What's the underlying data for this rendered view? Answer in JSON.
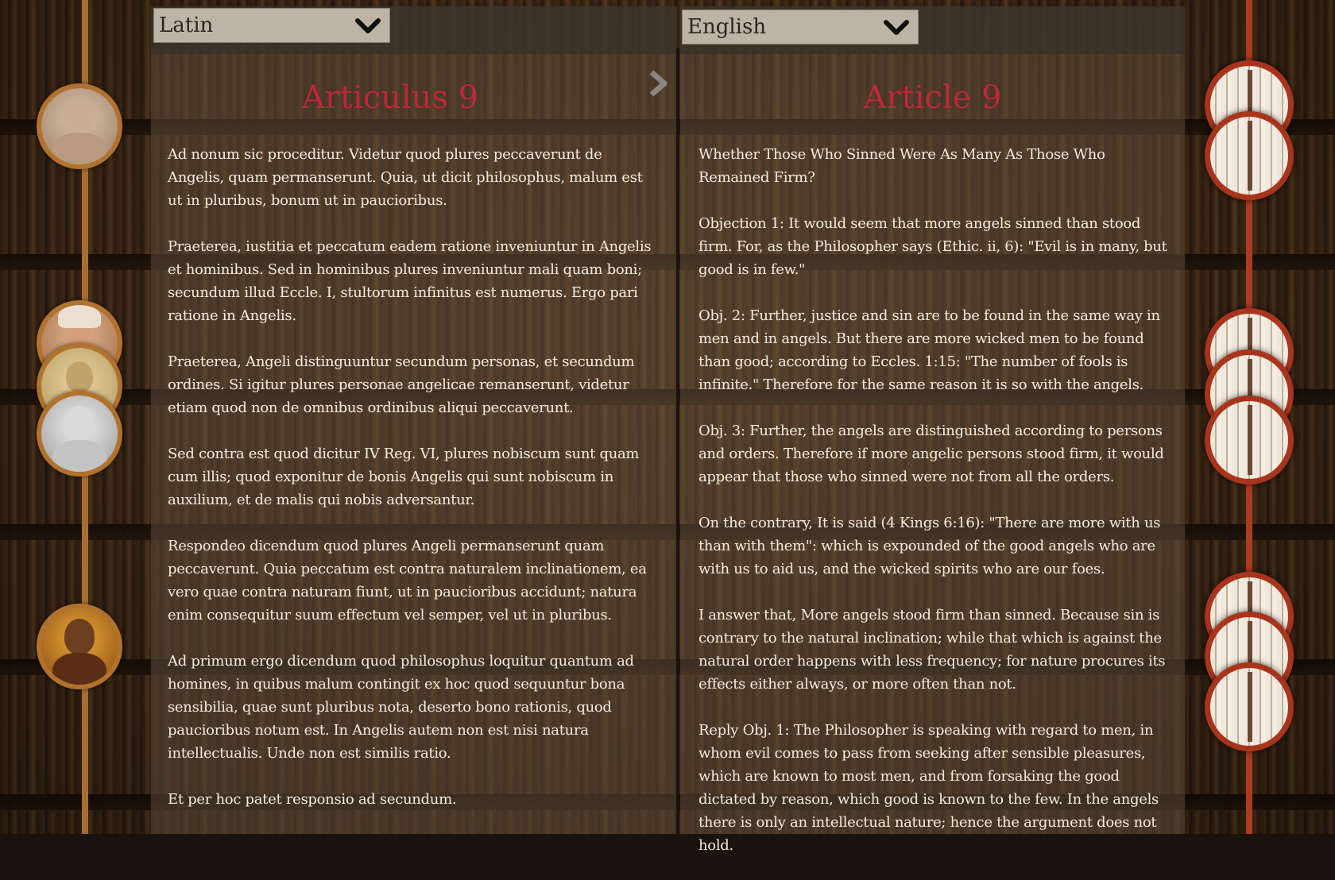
{
  "left_panel": {
    "language": "Latin",
    "heading": "Articulus 9",
    "paragraphs": [
      "Ad nonum sic proceditur. Videtur quod plures peccaverunt de Angelis, quam permanserunt. Quia, ut dicit philosophus, malum est ut in pluribus, bonum ut in paucioribus.",
      "Praeterea, iustitia et peccatum eadem ratione inveniuntur in Angelis et hominibus. Sed in hominibus plures inveniuntur mali quam boni; secundum illud Eccle. I, stultorum infinitus est numerus. Ergo pari ratione in Angelis.",
      "Praeterea, Angeli distinguuntur secundum personas, et secundum ordines. Si igitur plures personae angelicae remanserunt, videtur etiam quod non de omnibus ordinibus aliqui peccaverunt.",
      "Sed contra est quod dicitur IV Reg. VI, plures nobiscum sunt quam cum illis; quod exponitur de bonis Angelis qui sunt nobiscum in auxilium, et de malis qui nobis adversantur.",
      "Respondeo dicendum quod plures Angeli permanserunt quam peccaverunt. Quia peccatum est contra naturalem inclinationem, ea vero quae contra naturam fiunt, ut in paucioribus accidunt; natura enim consequitur suum effectum vel semper, vel ut in pluribus.",
      "Ad primum ergo dicendum quod philosophus loquitur quantum ad homines, in quibus malum contingit ex hoc quod sequuntur bona sensibilia, quae sunt pluribus nota, deserto bono rationis, quod paucioribus notum est. In Angelis autem non est nisi natura intellectualis. Unde non est similis ratio.",
      "Et per hoc patet responsio ad secundum."
    ]
  },
  "right_panel": {
    "language": "English",
    "heading": "Article 9",
    "paragraphs": [
      "Whether Those Who Sinned Were As Many As Those Who Remained Firm?",
      "Objection 1: It would seem that more angels sinned than stood firm. For, as the Philosopher says (Ethic. ii, 6): \"Evil is in many, but good is in few.\"",
      "Obj. 2: Further, justice and sin are to be found in the same way in men and in angels. But there are more wicked men to be found than good; according to Eccles. 1:15: \"The number of fools is infinite.\" Therefore for the same reason it is so with the angels.",
      "Obj. 3: Further, the angels are distinguished according to persons and orders. Therefore if more angelic persons stood firm, it would appear that those who sinned were not from all the orders.",
      "On the contrary, It is said (4 Kings 6:16): \"There are more with us than with them\": which is expounded of the good angels who are with us to aid us, and the wicked spirits who are our foes.",
      "I answer that, More angels stood firm than sinned. Because sin is contrary to the natural inclination; while that which is against the natural order happens with less frequency; for nature procures its effects either always, or more often than not.",
      "Reply Obj. 1: The Philosopher is speaking with regard to men, in whom evil comes to pass from seeking after sensible pleasures, which are known to most men, and from forsaking the good dictated by reason, which good is known to the few. In the angels there is only an intellectual nature; hence the argument does not hold."
    ]
  },
  "colors": {
    "heading": "#c0283a",
    "left_rail": "#a86d2e",
    "right_rail": "#b03a1e"
  },
  "icons": {
    "language_dropdown": "chevron-down-icon",
    "next_article": "chevron-right-icon"
  }
}
